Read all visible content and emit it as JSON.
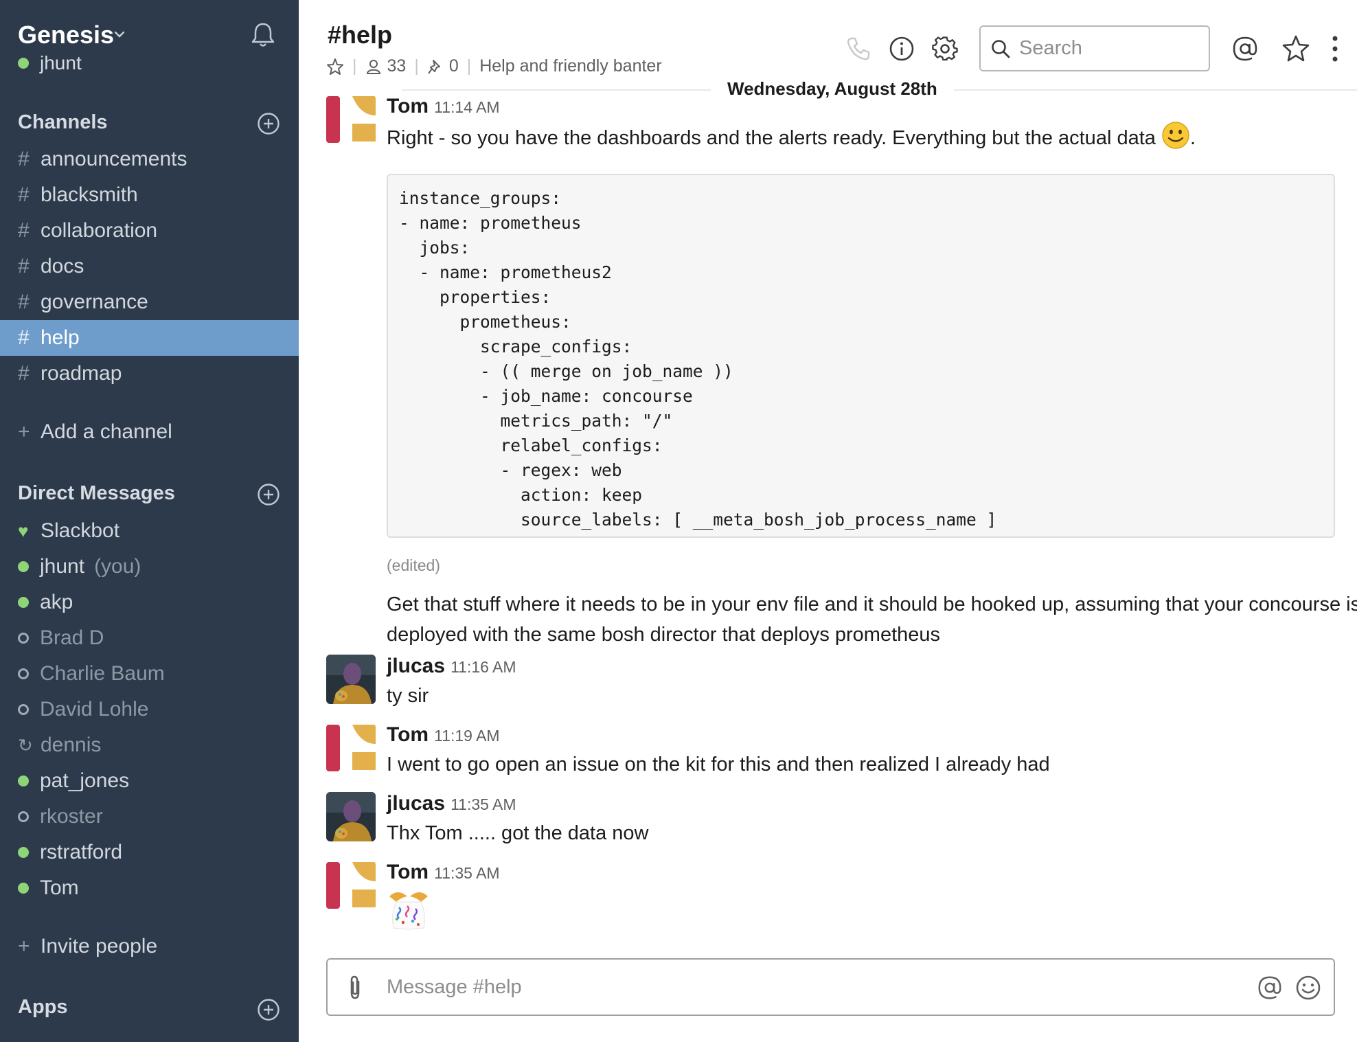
{
  "workspace": {
    "name": "Genesis",
    "current_user": "jhunt"
  },
  "sidebar": {
    "channels_header": "Channels",
    "channels": [
      {
        "name": "announcements"
      },
      {
        "name": "blacksmith"
      },
      {
        "name": "collaboration"
      },
      {
        "name": "docs"
      },
      {
        "name": "governance"
      },
      {
        "name": "help"
      },
      {
        "name": "roadmap"
      }
    ],
    "active_channel": "help",
    "add_channel": "Add a channel",
    "dm_header": "Direct Messages",
    "direct_messages": [
      {
        "name": "Slackbot",
        "status": "bot"
      },
      {
        "name": "jhunt",
        "suffix": "(you)",
        "status": "online"
      },
      {
        "name": "akp",
        "status": "online"
      },
      {
        "name": "Brad D",
        "status": "away"
      },
      {
        "name": "Charlie Baum",
        "status": "away"
      },
      {
        "name": "David Lohle",
        "status": "away"
      },
      {
        "name": "dennis",
        "status": "shared"
      },
      {
        "name": "pat_jones",
        "status": "online"
      },
      {
        "name": "rkoster",
        "status": "away"
      },
      {
        "name": "rstratford",
        "status": "online"
      },
      {
        "name": "Tom",
        "status": "online"
      }
    ],
    "invite": "Invite people",
    "apps_header": "Apps"
  },
  "header": {
    "channel_title": "#help",
    "members_count": "33",
    "pinned_count": "0",
    "topic": "Help and friendly banter",
    "search_placeholder": "Search"
  },
  "conversation": {
    "date_divider": "Wednesday, August 28th",
    "messages": [
      {
        "sender": "Tom",
        "time": "11:14 AM",
        "text": "Right - so you have the dashboards and the alerts ready. Everything but the actual data",
        "trailing": ".",
        "code": "instance_groups:\n- name: prometheus\n  jobs:\n  - name: prometheus2\n    properties:\n      prometheus:\n        scrape_configs:\n        - (( merge on job_name ))\n        - job_name: concourse\n          metrics_path: \"/\"\n          relabel_configs:\n          - regex: web\n            action: keep\n            source_labels: [ __meta_bosh_job_process_name ]",
        "edited": "(edited)",
        "followup": "Get that stuff where it needs to be in your env file and it should be hooked up, assuming that your concourse is deployed with the same bosh director that deploys prometheus"
      },
      {
        "sender": "jlucas",
        "time": "11:16 AM",
        "text": "ty sir"
      },
      {
        "sender": "Tom",
        "time": "11:19 AM",
        "text": "I went to go open an issue on the kit for this and then realized I already had"
      },
      {
        "sender": "jlucas",
        "time": "11:35 AM",
        "text": "Thx Tom ..... got the data now"
      },
      {
        "sender": "Tom",
        "time": "11:35 AM",
        "emoji": "tada"
      }
    ]
  },
  "composer": {
    "placeholder": "Message #help"
  },
  "colors": {
    "sidebar_bg": "#2c3a4c",
    "active_channel_bg": "#6e9dcb",
    "presence_online": "#8ed577",
    "tom_avatar_red": "#c8334f",
    "tom_avatar_gold": "#e3b04b"
  },
  "icons": [
    "chevron-down-icon",
    "bell-icon",
    "add-circle-icon",
    "star-icon",
    "members-icon",
    "pin-icon",
    "phone-icon",
    "info-icon",
    "gear-icon",
    "search-icon",
    "mention-icon",
    "more-vertical-icon",
    "attach-icon",
    "emoji-icon",
    "heart-icon",
    "shared-channel-icon",
    "tada-emoji-icon",
    "smiley-emoji-icon"
  ]
}
